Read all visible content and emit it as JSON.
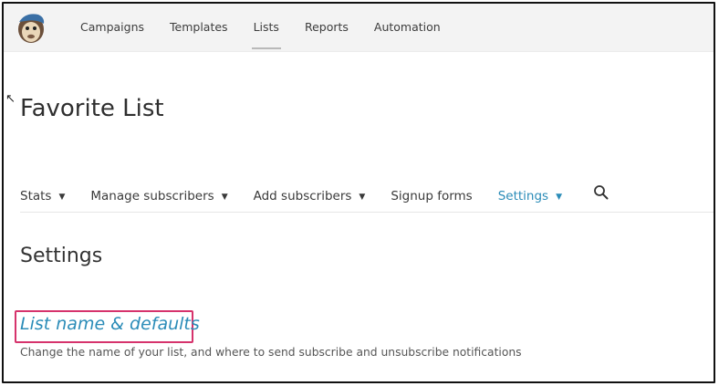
{
  "topnav": {
    "logo_icon": "mailchimp-freddie-logo",
    "items": [
      {
        "label": "Campaigns",
        "active": false
      },
      {
        "label": "Templates",
        "active": false
      },
      {
        "label": "Lists",
        "active": true
      },
      {
        "label": "Reports",
        "active": false
      },
      {
        "label": "Automation",
        "active": false
      }
    ]
  },
  "page": {
    "title": "Favorite List"
  },
  "subnav": {
    "items": [
      {
        "label": "Stats",
        "has_dropdown": true,
        "active": false
      },
      {
        "label": "Manage subscribers",
        "has_dropdown": true,
        "active": false
      },
      {
        "label": "Add subscribers",
        "has_dropdown": true,
        "active": false
      },
      {
        "label": "Signup forms",
        "has_dropdown": false,
        "active": false
      },
      {
        "label": "Settings",
        "has_dropdown": true,
        "active": true
      }
    ],
    "search_icon": "search-icon",
    "active_color": "#2b8cb8"
  },
  "settings": {
    "heading": "Settings",
    "link_label": "List name & defaults",
    "link_description": "Change the name of your list, and where to send subscribe and unsubscribe notifications",
    "highlight_color": "#d6336c"
  }
}
